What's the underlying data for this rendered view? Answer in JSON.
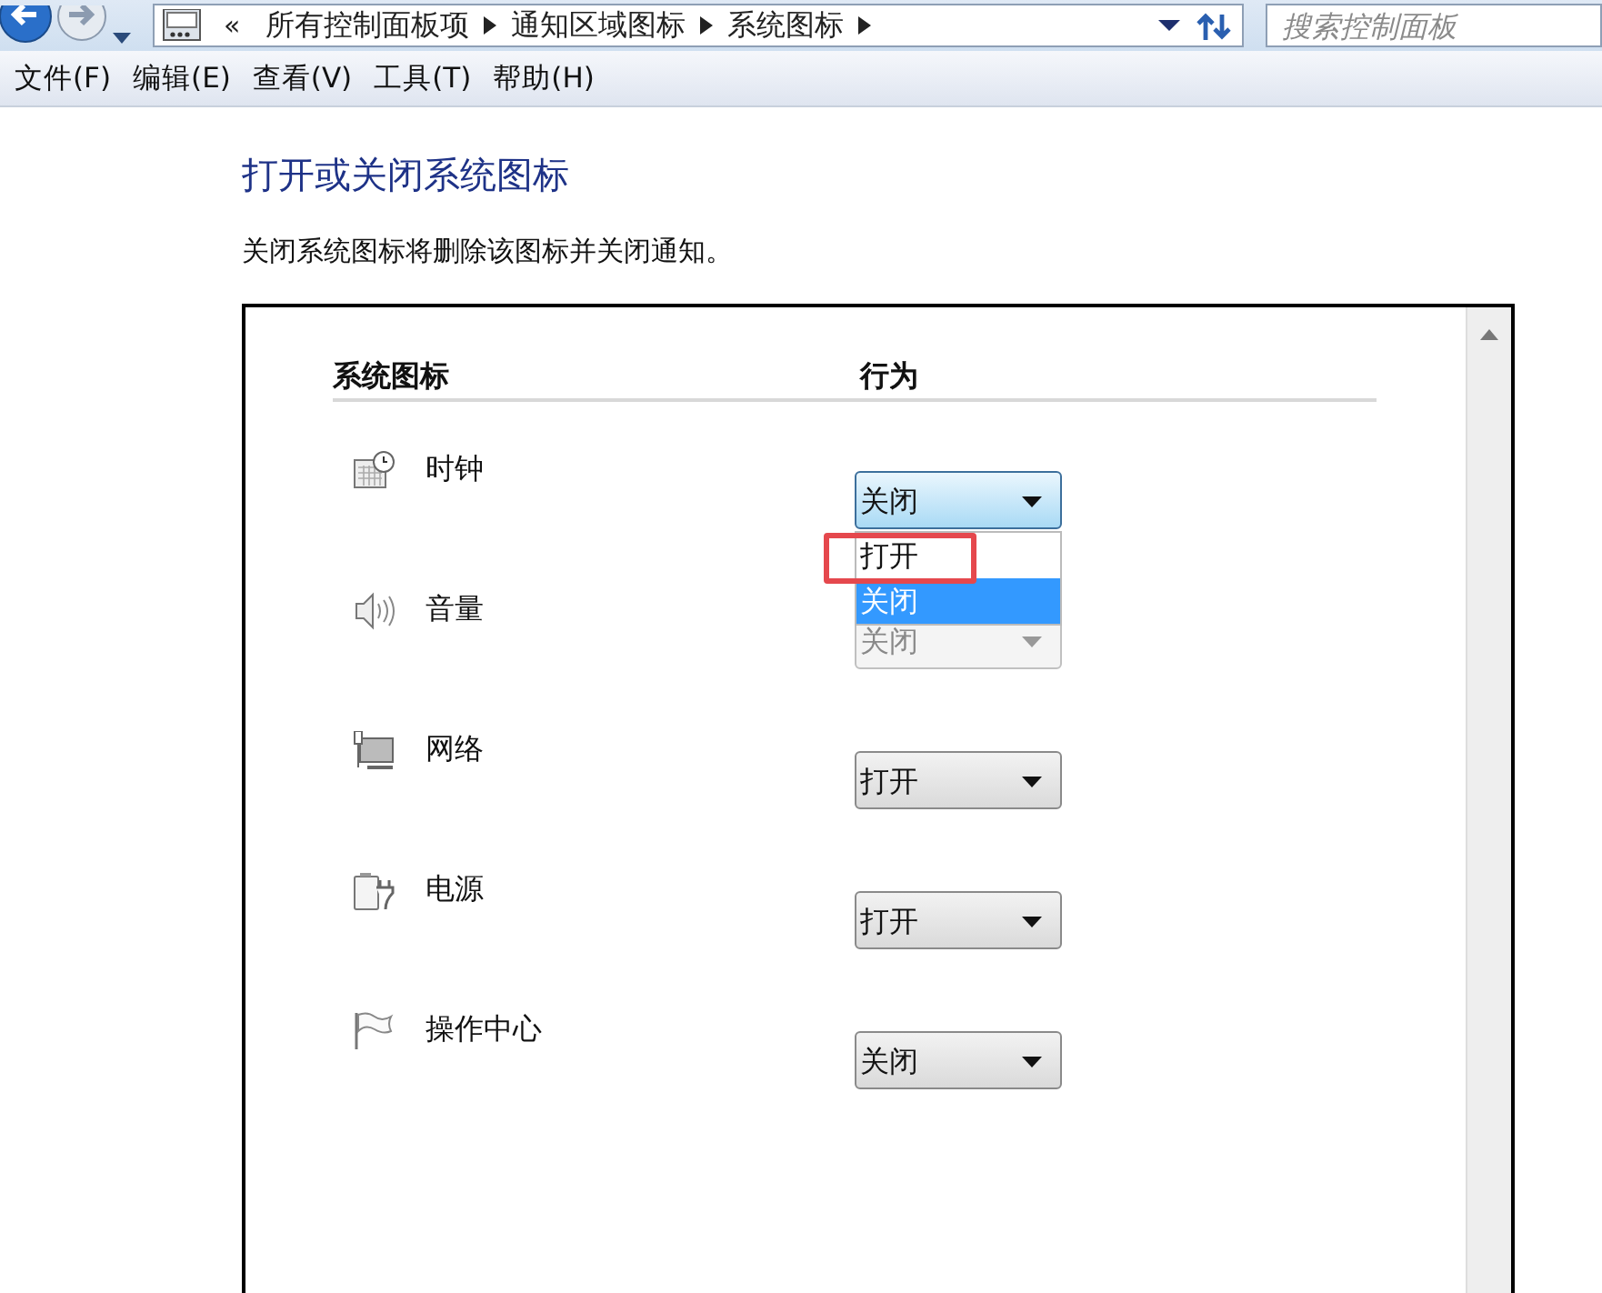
{
  "address_bar": {
    "overflow": "«",
    "breadcrumbs": [
      "所有控制面板项",
      "通知区域图标",
      "系统图标"
    ]
  },
  "search": {
    "placeholder": "搜索控制面板"
  },
  "menu": [
    "文件(F)",
    "编辑(E)",
    "查看(V)",
    "工具(T)",
    "帮助(H)"
  ],
  "heading": "打开或关闭系统图标",
  "description": "关闭系统图标将删除该图标并关闭通知。",
  "table": {
    "columns": [
      "系统图标",
      "行为"
    ],
    "rows": [
      {
        "kind": "clock",
        "name": "时钟",
        "value": "关闭",
        "disabled": false,
        "open": true,
        "options": [
          {
            "label": "打开",
            "selected": false,
            "highlighted": true
          },
          {
            "label": "关闭",
            "selected": true,
            "highlighted": false
          }
        ]
      },
      {
        "kind": "volume",
        "name": "音量",
        "value": "关闭",
        "disabled": true,
        "open": false
      },
      {
        "kind": "network",
        "name": "网络",
        "value": "打开",
        "disabled": false,
        "open": false
      },
      {
        "kind": "power",
        "name": "电源",
        "value": "打开",
        "disabled": false,
        "open": false
      },
      {
        "kind": "flag",
        "name": "操作中心",
        "value": "关闭",
        "disabled": false,
        "open": false
      }
    ]
  }
}
